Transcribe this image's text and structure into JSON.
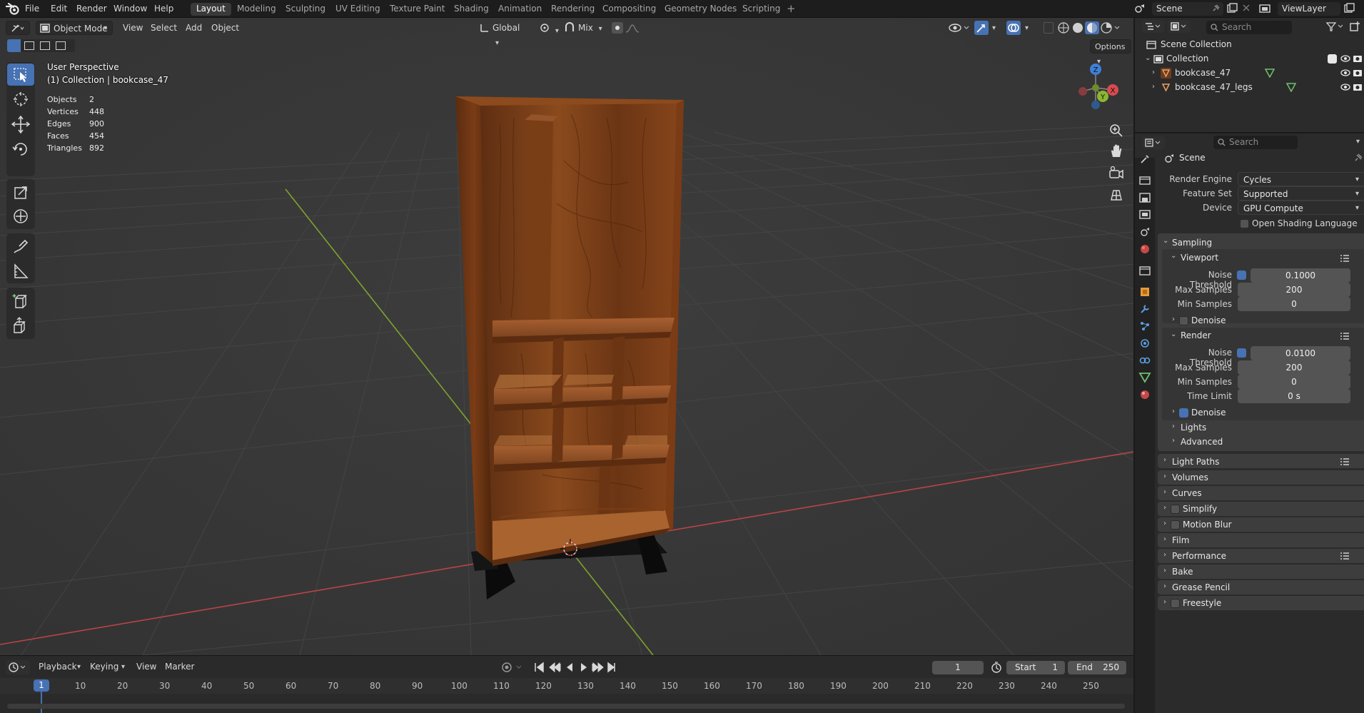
{
  "menubar": {
    "items": [
      "File",
      "Edit",
      "Render",
      "Window",
      "Help"
    ],
    "workspaces": [
      "Layout",
      "Modeling",
      "Sculpting",
      "UV Editing",
      "Texture Paint",
      "Shading",
      "Animation",
      "Rendering",
      "Compositing",
      "Geometry Nodes",
      "Scripting"
    ],
    "active_workspace": "Layout",
    "scene": "Scene",
    "view_layer": "ViewLayer"
  },
  "viewport": {
    "mode": "Object Mode",
    "menus": [
      "View",
      "Select",
      "Add",
      "Object"
    ],
    "transform_orientation": "Global",
    "snap_mode": "Mix",
    "options_label": "Options",
    "perspective_label": "User Perspective",
    "collection_label": "(1) Collection | bookcase_47",
    "stats": [
      {
        "key": "Objects",
        "value": "2"
      },
      {
        "key": "Vertices",
        "value": "448"
      },
      {
        "key": "Edges",
        "value": "900"
      },
      {
        "key": "Faces",
        "value": "454"
      },
      {
        "key": "Triangles",
        "value": "892"
      }
    ],
    "gizmo_axes": {
      "x": "X",
      "y": "Y",
      "z": "Z"
    },
    "colors": {
      "background": "#393939",
      "x_axis": "#b94447",
      "y_axis": "#7ea22d",
      "active_tool": "#4772b3"
    },
    "tools": [
      "select-box-icon",
      "cursor-icon",
      "move-icon",
      "rotate-icon",
      "scale-icon",
      "transform-icon",
      "annotate-icon",
      "measure-icon",
      "add-cube-icon",
      "extrude-icon"
    ]
  },
  "timeline": {
    "menus": [
      "Playback",
      "Keying",
      "View",
      "Marker"
    ],
    "current_frame": "1",
    "start_label": "Start",
    "start": "1",
    "end_label": "End",
    "end": "250",
    "ruler": [
      "1",
      "10",
      "20",
      "30",
      "40",
      "50",
      "60",
      "70",
      "80",
      "90",
      "100",
      "110",
      "120",
      "130",
      "140",
      "150",
      "160",
      "170",
      "180",
      "190",
      "200",
      "210",
      "220",
      "230",
      "240",
      "250"
    ]
  },
  "outliner": {
    "search_placeholder": "Search",
    "scene_collection": "Scene Collection",
    "collection": "Collection",
    "objects": [
      "bookcase_47",
      "bookcase_47_legs"
    ]
  },
  "properties": {
    "search_placeholder": "Search",
    "context": "Scene",
    "render_engine_label": "Render Engine",
    "render_engine": "Cycles",
    "feature_set_label": "Feature Set",
    "feature_set": "Supported",
    "device_label": "Device",
    "device": "GPU Compute",
    "osl_label": "Open Shading Language",
    "sampling": {
      "title": "Sampling",
      "viewport": {
        "title": "Viewport",
        "noise_threshold_label": "Noise Threshold",
        "noise_threshold": "0.1000",
        "max_samples_label": "Max Samples",
        "max_samples": "200",
        "min_samples_label": "Min Samples",
        "min_samples": "0",
        "denoise_label": "Denoise"
      },
      "render": {
        "title": "Render",
        "noise_threshold_label": "Noise Threshold",
        "noise_threshold": "0.0100",
        "max_samples_label": "Max Samples",
        "max_samples": "200",
        "min_samples_label": "Min Samples",
        "min_samples": "0",
        "time_limit_label": "Time Limit",
        "time_limit": "0 s",
        "denoise_label": "Denoise"
      },
      "lights": "Lights",
      "advanced": "Advanced"
    },
    "panels": [
      "Light Paths",
      "Volumes",
      "Curves",
      "Simplify",
      "Motion Blur",
      "Film",
      "Performance",
      "Bake",
      "Grease Pencil",
      "Freestyle"
    ]
  }
}
